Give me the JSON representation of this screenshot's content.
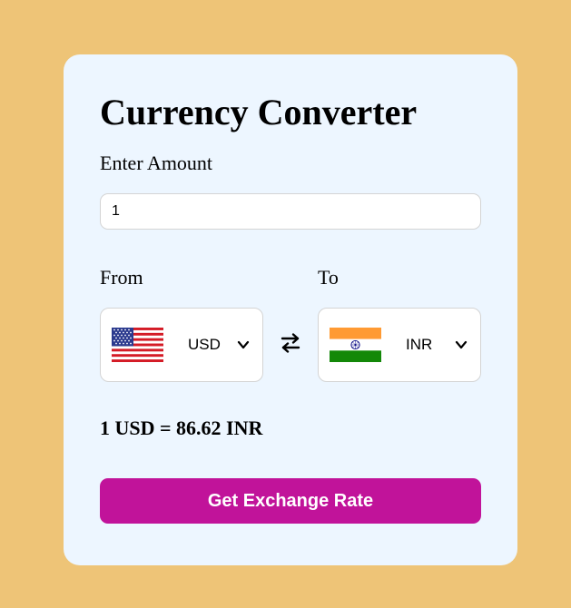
{
  "converter": {
    "title": "Currency Converter",
    "amount_label": "Enter Amount",
    "amount_value": "1",
    "from_label": "From",
    "to_label": "To",
    "from_currency": "USD",
    "to_currency": "INR",
    "from_flag_icon": "us-flag-icon",
    "to_flag_icon": "india-flag-icon",
    "swap_icon": "swap-arrows-icon",
    "result_text": "1 USD = 86.62 INR",
    "button_label": "Get Exchange Rate"
  },
  "colors": {
    "page_background": "#eec477",
    "card_background": "#edf6ff",
    "button_background": "#c1139a",
    "button_text": "#ffffff"
  }
}
